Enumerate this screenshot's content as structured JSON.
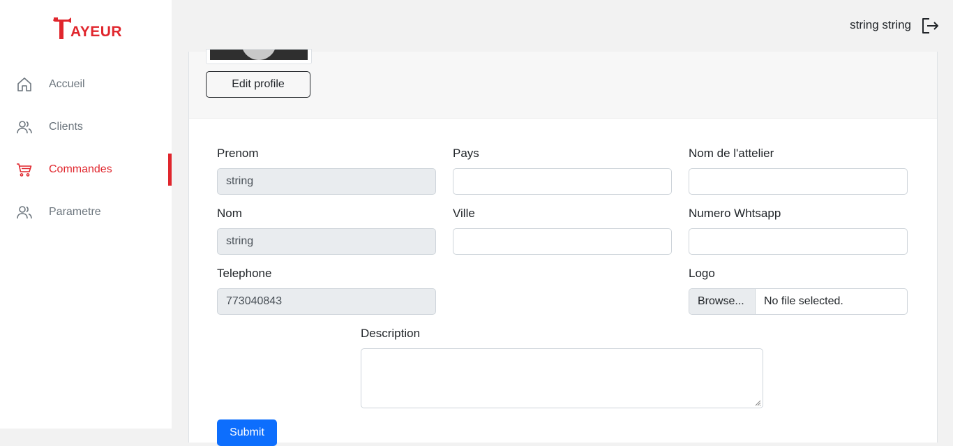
{
  "brand": {
    "logo_text": "AYEUR",
    "logo_letter": "T",
    "accent": "#e0262d"
  },
  "sidebar": {
    "items": [
      {
        "label": "Accueil",
        "icon": "home-icon",
        "active": false
      },
      {
        "label": "Clients",
        "icon": "users-icon",
        "active": false
      },
      {
        "label": "Commandes",
        "icon": "cart-icon",
        "active": true
      },
      {
        "label": "Parametre",
        "icon": "users-icon",
        "active": false
      }
    ]
  },
  "header": {
    "user_name": "string string",
    "logout_icon": "logout-icon"
  },
  "profile": {
    "edit_label": "Edit profile"
  },
  "form": {
    "prenom": {
      "label": "Prenom",
      "value": "string"
    },
    "nom": {
      "label": "Nom",
      "value": "string"
    },
    "telephone": {
      "label": "Telephone",
      "value": "773040843"
    },
    "pays": {
      "label": "Pays",
      "value": ""
    },
    "ville": {
      "label": "Ville",
      "value": ""
    },
    "atelier": {
      "label": "Nom de l'attelier",
      "value": ""
    },
    "whatsapp": {
      "label": "Numero Whtsapp",
      "value": ""
    },
    "logo": {
      "label": "Logo",
      "browse": "Browse...",
      "status": "No file selected."
    },
    "description": {
      "label": "Description",
      "value": ""
    },
    "submit_label": "Submit"
  }
}
